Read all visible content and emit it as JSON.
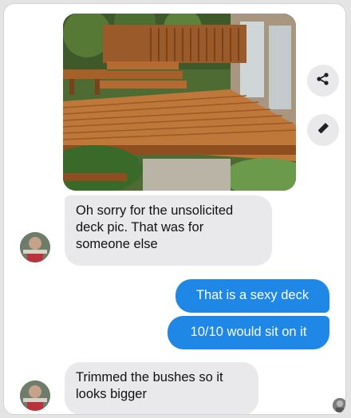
{
  "photo": {
    "icon": "deck-photo"
  },
  "actions": {
    "share_icon": "share-icon",
    "edit_icon": "pencil-icon"
  },
  "messages": [
    {
      "from": "them",
      "text": "Oh sorry for the unsolicited deck pic. That was for someone else"
    },
    {
      "from": "me",
      "text": "That is a sexy deck"
    },
    {
      "from": "me",
      "text": "10/10 would sit on it"
    },
    {
      "from": "them",
      "text": "Trimmed the bushes so it looks bigger"
    }
  ],
  "colors": {
    "sent": "#1f87e6",
    "received": "#e9e9eb"
  }
}
